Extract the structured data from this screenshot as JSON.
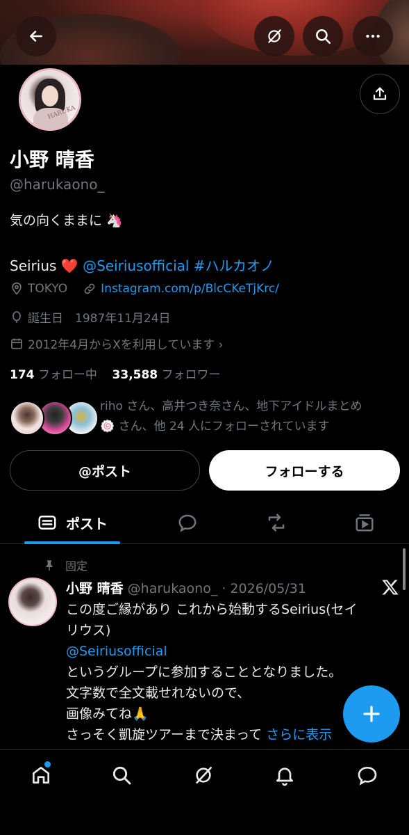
{
  "header": {
    "back_icon": "arrow-left-icon",
    "grok_icon": "grok-icon",
    "search_icon": "search-icon",
    "more_icon": "more-horizontal-icon"
  },
  "profile": {
    "avatar_text": "HARUKA",
    "name": "小野 晴香",
    "handle": "@harukaono_",
    "bio_line1": "気の向くままに 🦄",
    "bio_line2_prefix": "Seirius ❤️ ",
    "bio_mention": "@Seiriusofficial",
    "bio_hashtag": "#ハルカオノ",
    "location": "TOKYO",
    "website": "Instagram.com/p/BlcCKeTjKrc/",
    "birthday": "誕生日　1987年11月24日",
    "joined": "2012年4月からXを利用しています ›",
    "following_count": "174",
    "following_label": "フォロー中",
    "followers_count": "33,588",
    "followers_label": "フォロワー",
    "followed_by_line1": "riho さん、高井つき奈さん、地下アイドルまとめ",
    "followed_by_line2": "🍥 さん、他 24 人にフォローされています"
  },
  "actions": {
    "post_button": "@ポスト",
    "follow_button": "フォローする"
  },
  "tabs": {
    "posts_label": "ポスト",
    "active": "posts"
  },
  "pinned_post": {
    "pinned_label": "固定",
    "author_name": "小野 晴香",
    "author_meta": "@harukaono_ · 2026/05/31",
    "line1": "この度ご縁があり これから始動するSeirius(セイ",
    "line2": "リウス)",
    "mention": "@Seiriusofficial",
    "line3": "というグループに参加することとなりました。",
    "line4": "文字数で全文載せれないので、",
    "line5": "画像みてね🙏",
    "line6": "さっそく凱旋ツアーまで決まって ",
    "more_link": "さらに表示"
  },
  "colors": {
    "accent": "#1d9bf0",
    "muted": "#71767b",
    "background": "#000000"
  }
}
